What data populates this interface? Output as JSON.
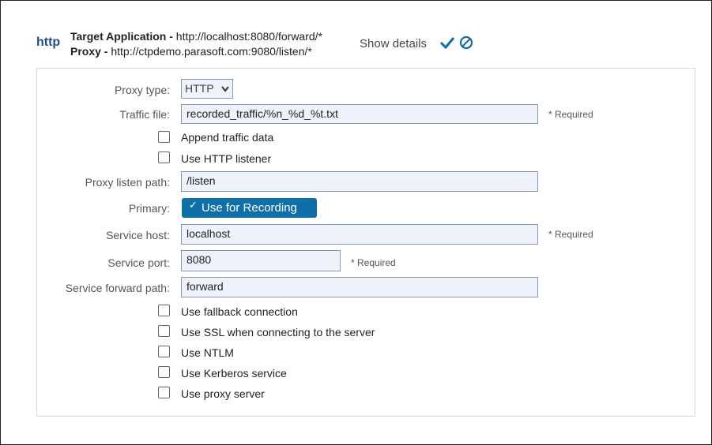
{
  "header": {
    "protocol": "http",
    "target_label": "Target Application -",
    "target_url": "http://localhost:8080/forward/*",
    "proxy_label": "Proxy -",
    "proxy_url": "http://ctpdemo.parasoft.com:9080/listen/*",
    "show_details": "Show details",
    "icons": [
      "check-icon",
      "cancel-icon"
    ]
  },
  "form": {
    "proxy_type": {
      "label": "Proxy type:",
      "value": "HTTP"
    },
    "traffic_file": {
      "label": "Traffic file:",
      "value": "recorded_traffic/%n_%d_%t.txt",
      "required": "* Required"
    },
    "append_traffic": {
      "label": "Append traffic data",
      "checked": false
    },
    "use_http_listener": {
      "label": "Use HTTP listener",
      "checked": false
    },
    "proxy_listen_path": {
      "label": "Proxy listen path:",
      "value": "/listen"
    },
    "primary": {
      "label": "Primary:",
      "toggle_label": "Use for Recording",
      "checked": true,
      "tick": "✓"
    },
    "service_host": {
      "label": "Service host:",
      "value": "localhost",
      "required": "* Required"
    },
    "service_port": {
      "label": "Service port:",
      "value": "8080",
      "required": "* Required"
    },
    "service_forward_path": {
      "label": "Service forward path:",
      "value": "forward"
    },
    "options": [
      {
        "label": "Use fallback connection",
        "checked": false
      },
      {
        "label": "Use SSL when connecting to the server",
        "checked": false
      },
      {
        "label": "Use NTLM",
        "checked": false
      },
      {
        "label": "Use Kerberos service",
        "checked": false
      },
      {
        "label": "Use proxy server",
        "checked": false
      }
    ]
  },
  "colors": {
    "accent": "#0f6fa8",
    "protocol": "#1f4e8c",
    "input_bg": "#eef2fa"
  }
}
